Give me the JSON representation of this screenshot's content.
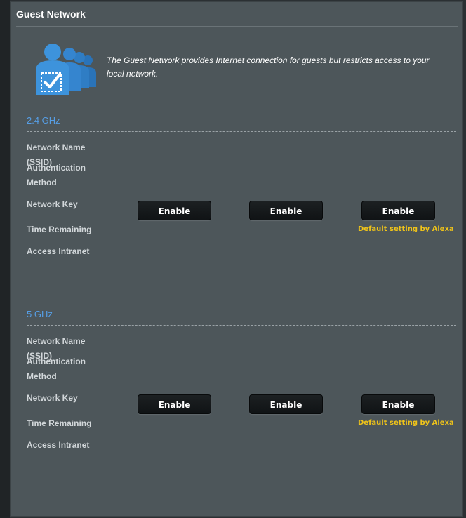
{
  "page": {
    "title": "Guest Network",
    "intro": "The Guest Network provides Internet connection for guests but restricts access to your local network."
  },
  "icon": {
    "name": "guest-users-icon",
    "colors": {
      "figure": "#3a8fd8",
      "figure_dark": "#2a73b8"
    }
  },
  "colors": {
    "panel": "#4d565a",
    "section_title": "#569ee5",
    "note": "#f0c419"
  },
  "bands": [
    {
      "title": "2.4 GHz",
      "fields": {
        "ssid": "Network Name (SSID)",
        "auth_line1": "Authentication",
        "auth_line2": "Method",
        "key": "Network Key",
        "time": "Time Remaining",
        "intranet": "Access Intranet"
      },
      "buttons": [
        "Enable",
        "Enable",
        "Enable"
      ],
      "note": "Default setting by Alexa"
    },
    {
      "title": "5 GHz",
      "fields": {
        "ssid": "Network Name (SSID)",
        "auth_line1": "Authentication",
        "auth_line2": "Method",
        "key": "Network Key",
        "time": "Time Remaining",
        "intranet": "Access Intranet"
      },
      "buttons": [
        "Enable",
        "Enable",
        "Enable"
      ],
      "note": "Default setting by Alexa"
    }
  ]
}
